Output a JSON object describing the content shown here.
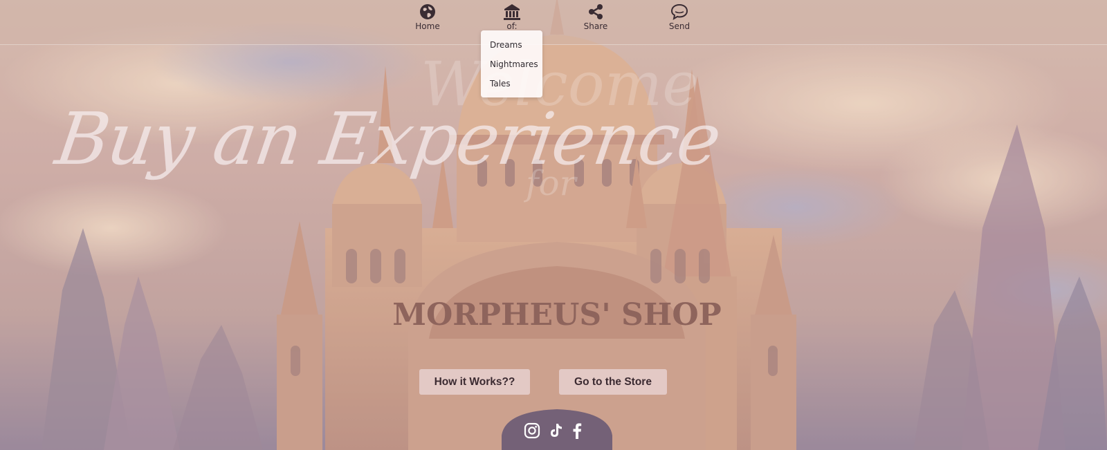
{
  "nav": {
    "items": [
      {
        "label": "Home",
        "icon": "globe-icon"
      },
      {
        "label": "of:",
        "icon": "museum-icon"
      },
      {
        "label": "Share",
        "icon": "share-icon"
      },
      {
        "label": "Send",
        "icon": "chat-bubble-icon"
      }
    ]
  },
  "dropdown": {
    "items": [
      "Dreams",
      "Nightmares",
      "Tales"
    ]
  },
  "hero": {
    "welcome": "Welcome",
    "for": "for",
    "headline": "Buy an Experience",
    "sign_text": "MORPHEUS' SHOP"
  },
  "buttons": {
    "how": "How it Works??",
    "store": "Go to the Store"
  },
  "social": [
    "instagram-icon",
    "tiktok-icon",
    "facebook-icon"
  ],
  "colors": {
    "nav_bg": "#d0b4aa",
    "text_dark": "#3a2c33",
    "button_bg": "#f0e2e6",
    "headline": "#f6eef0"
  }
}
